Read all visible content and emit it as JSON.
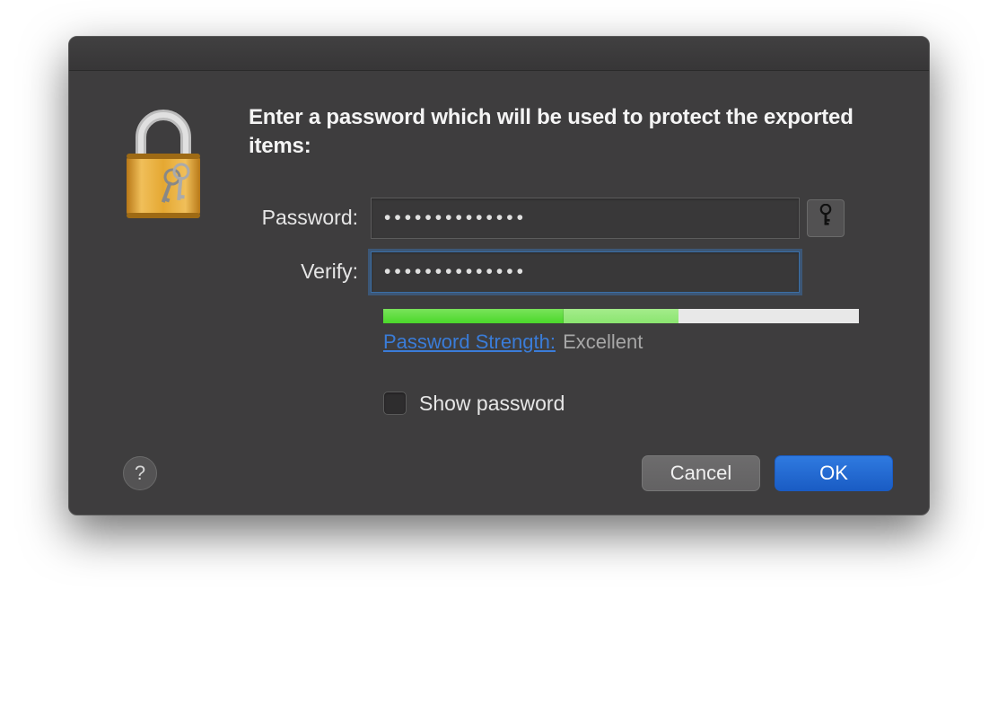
{
  "dialog": {
    "prompt": "Enter a password which will be used to protect the exported items:",
    "labels": {
      "password": "Password:",
      "verify": "Verify:"
    },
    "fields": {
      "password_value": "••••••••••••••",
      "verify_value": "••••••••••••••"
    },
    "strength": {
      "link_label": "Password Strength:",
      "rating": "Excellent",
      "fill1_percent": 38,
      "fill2_percent": 24
    },
    "show_password_label": "Show password",
    "show_password_checked": false,
    "buttons": {
      "cancel": "Cancel",
      "ok": "OK"
    },
    "help_glyph": "?",
    "icons": {
      "lock": "lock-icon",
      "key": "key-icon"
    }
  }
}
